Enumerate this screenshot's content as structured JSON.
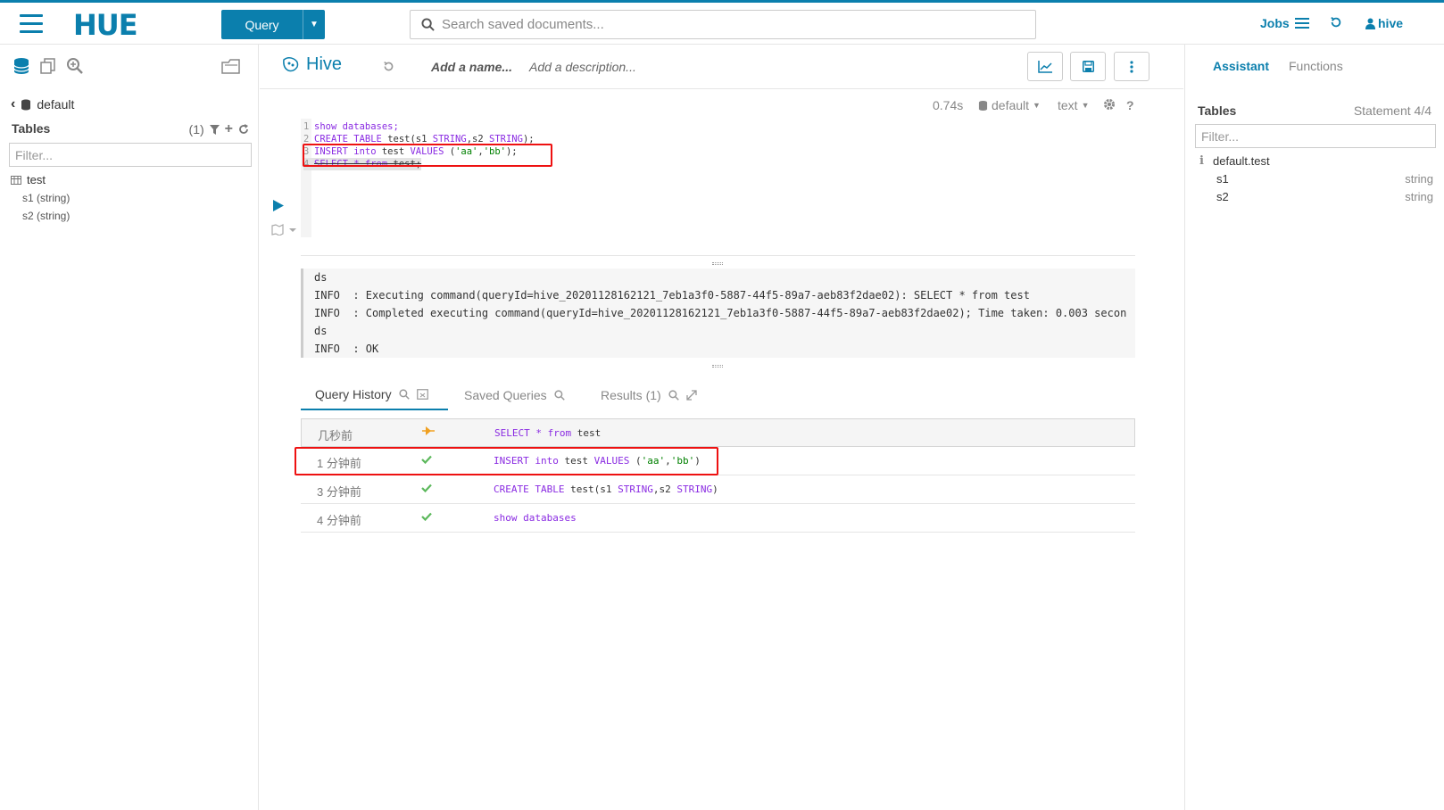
{
  "topbar": {
    "logo": "HUE",
    "query_label": "Query",
    "search_placeholder": "Search saved documents...",
    "jobs_label": "Jobs",
    "user_label": "hive"
  },
  "leftpanel": {
    "database": "default",
    "tables_label": "Tables",
    "tables_count": "(1)",
    "filter_placeholder": "Filter...",
    "table_name": "test",
    "columns": [
      "s1 (string)",
      "s2 (string)"
    ]
  },
  "editor_header": {
    "title": "Hive",
    "name_placeholder": "Add a name...",
    "description_placeholder": "Add a description...",
    "duration": "0.74s",
    "database": "default",
    "format": "text"
  },
  "editor": {
    "lines": [
      {
        "n": "1",
        "text": "show databases;"
      },
      {
        "n": "2",
        "text": "CREATE TABLE test(s1 STRING,s2 STRING);"
      },
      {
        "n": "3",
        "text": "INSERT into test VALUES ('aa','bb');"
      },
      {
        "n": "4",
        "text": "SELECT * from test;"
      }
    ]
  },
  "log": {
    "lines": [
      "ds",
      "INFO  : Executing command(queryId=hive_20201128162121_7eb1a3f0-5887-44f5-89a7-aeb83f2dae02): SELECT * from test",
      "INFO  : Completed executing command(queryId=hive_20201128162121_7eb1a3f0-5887-44f5-89a7-aeb83f2dae02); Time taken: 0.003 secon",
      "ds",
      "INFO  : OK"
    ]
  },
  "tabs": {
    "history": "Query History",
    "saved": "Saved Queries",
    "results": "Results (1)"
  },
  "history": [
    {
      "time": "几秒前",
      "status": "running",
      "query": "SELECT * from test"
    },
    {
      "time": "1 分钟前",
      "status": "success",
      "query": "INSERT into test VALUES ('aa','bb')"
    },
    {
      "time": "3 分钟前",
      "status": "success",
      "query": "CREATE TABLE test(s1 STRING,s2 STRING)"
    },
    {
      "time": "4 分钟前",
      "status": "success",
      "query": "show databases"
    }
  ],
  "rightpanel": {
    "assistant_tab": "Assistant",
    "functions_tab": "Functions",
    "tables_label": "Tables",
    "statement": "Statement 4/4",
    "filter_placeholder": "Filter...",
    "table": "default.test",
    "columns": [
      {
        "name": "s1",
        "type": "string"
      },
      {
        "name": "s2",
        "type": "string"
      }
    ]
  },
  "colors": {
    "brand": "#0b7fad",
    "highlight": "#e11111",
    "success": "#5cb85c",
    "running": "#f0a020"
  }
}
